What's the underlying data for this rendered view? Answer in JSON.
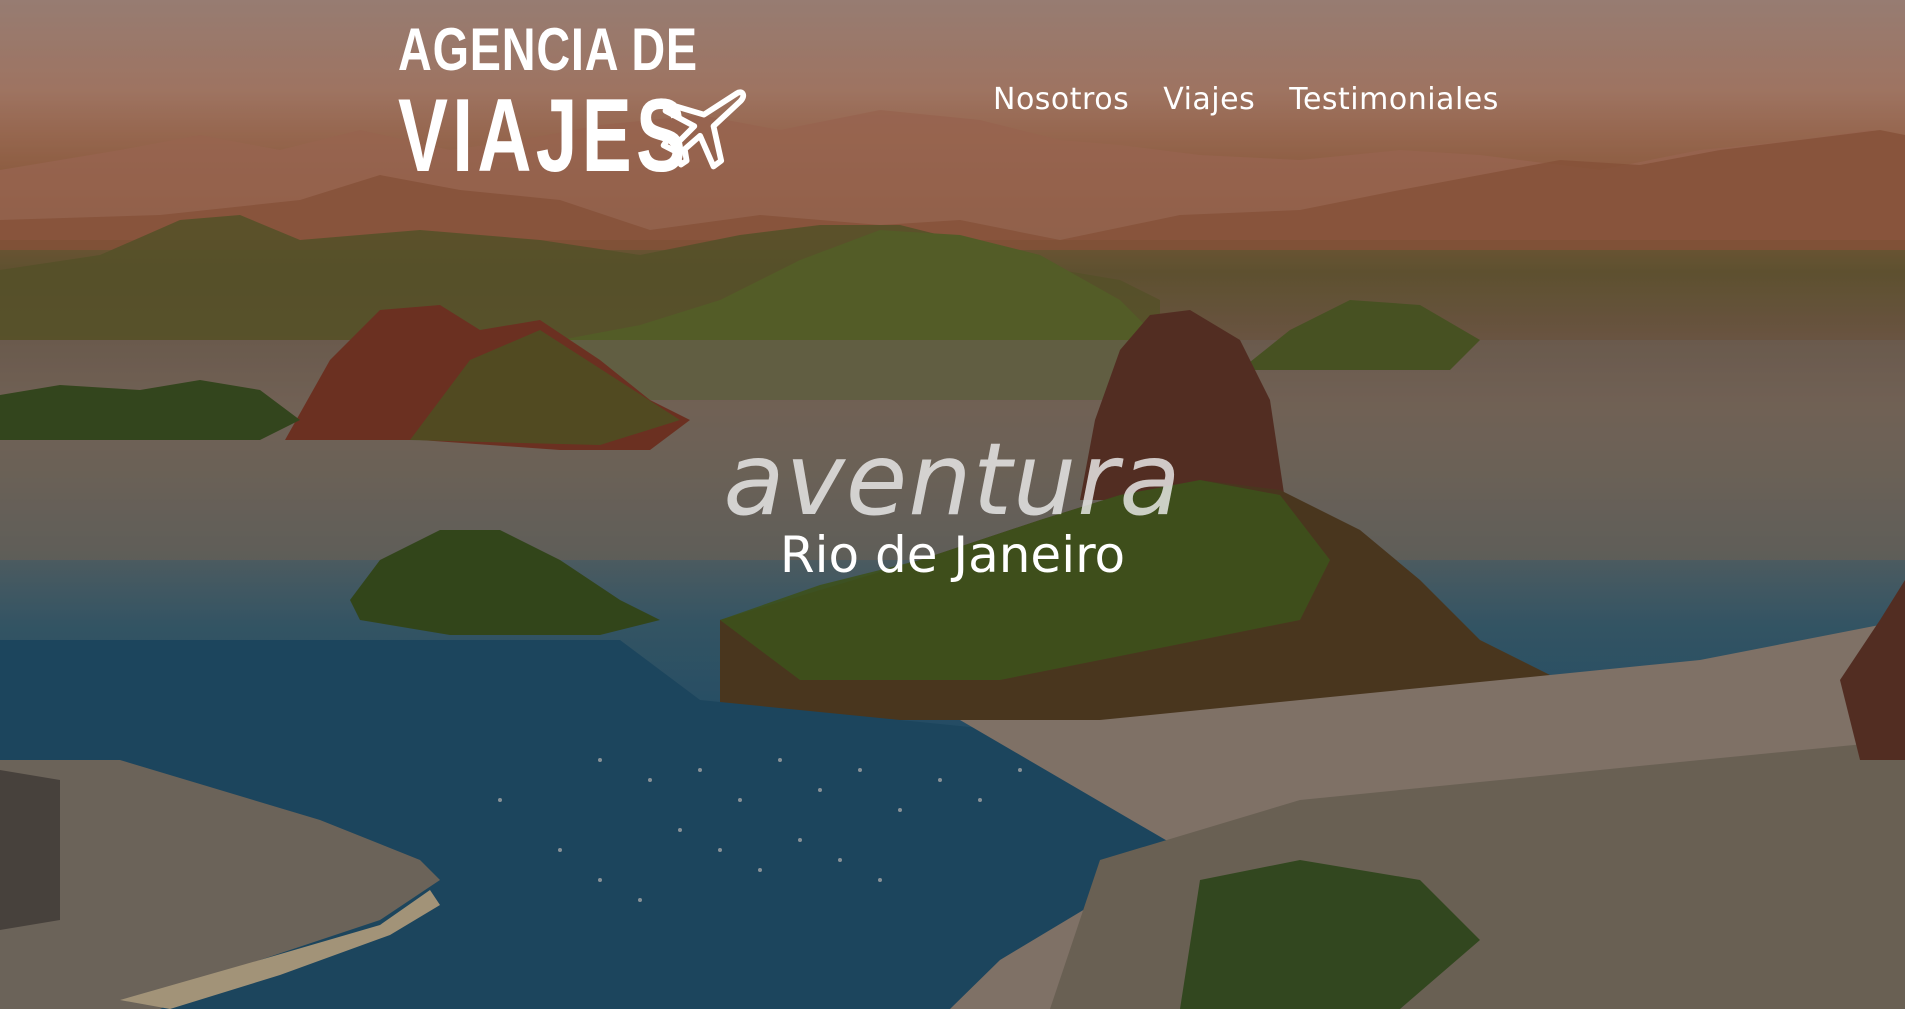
{
  "logo": {
    "line1": "AGENCIA DE",
    "line2": "VIAJES",
    "icon": "airplane-icon"
  },
  "nav": {
    "items": [
      {
        "label": "Nosotros"
      },
      {
        "label": "Viajes"
      },
      {
        "label": "Testimoniales"
      }
    ]
  },
  "hero": {
    "tagline": "aventura",
    "subtitle": "Rio de Janeiro",
    "image": "rio-de-janeiro-bay-photo"
  },
  "colors": {
    "text": "#ffffff",
    "tagline": "#ebebeb"
  }
}
